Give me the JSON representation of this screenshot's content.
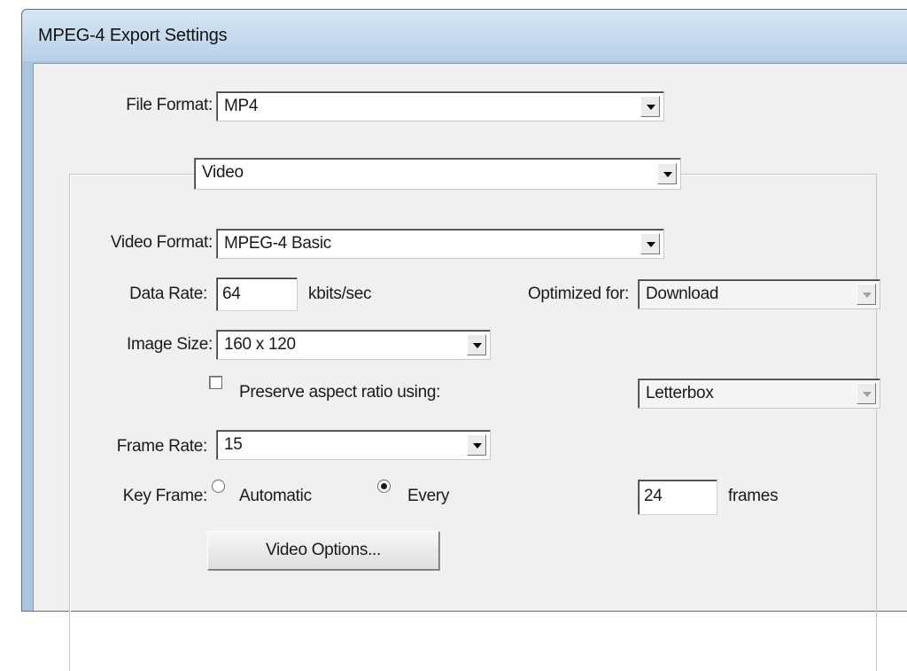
{
  "window": {
    "title": "MPEG-4 Export Settings"
  },
  "file_format": {
    "label": "File Format:",
    "value": "MP4"
  },
  "section": {
    "value": "Video"
  },
  "video_format": {
    "label": "Video Format:",
    "value": "MPEG-4 Basic"
  },
  "data_rate": {
    "label": "Data Rate:",
    "value": "64",
    "unit": "kbits/sec"
  },
  "optimized_for": {
    "label": "Optimized for:",
    "value": "Download"
  },
  "image_size": {
    "label": "Image Size:",
    "value": "160 x 120"
  },
  "preserve_aspect": {
    "label": "Preserve aspect ratio using:",
    "checked": false,
    "mode": "Letterbox"
  },
  "frame_rate": {
    "label": "Frame Rate:",
    "value": "15"
  },
  "key_frame": {
    "label": "Key Frame:",
    "automatic_label": "Automatic",
    "every_label": "Every",
    "selected": "Every",
    "value": "24",
    "unit": "frames"
  },
  "video_options_button": {
    "label": "Video Options..."
  }
}
